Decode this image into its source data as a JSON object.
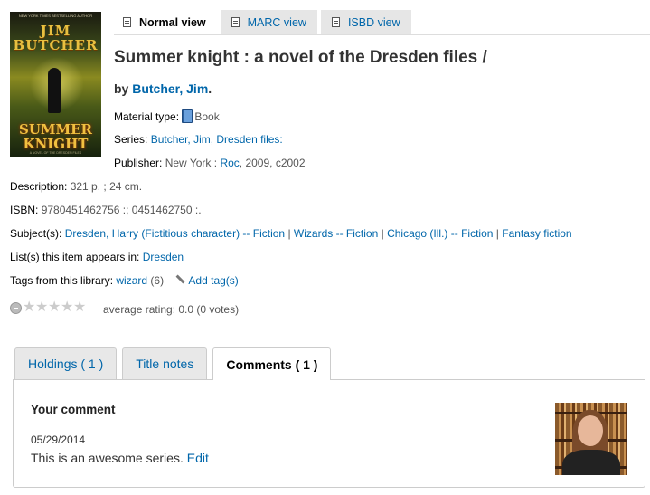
{
  "cover": {
    "tagline": "NEW YORK TIMES BESTSELLING AUTHOR",
    "author_line1": "JIM",
    "author_line2": "BUTCHER",
    "title_line1": "SUMMER",
    "title_line2": "KNIGHT",
    "subtitle": "A NOVEL OF THE DRESDEN FILES"
  },
  "view_tabs": [
    {
      "label": "Normal view",
      "icon": "document-icon"
    },
    {
      "label": "MARC view",
      "icon": "table-icon"
    },
    {
      "label": "ISBD view",
      "icon": "folder-icon"
    }
  ],
  "record": {
    "title": "Summer knight : a novel of the Dresden files /",
    "by_label": "by",
    "author": "Butcher, Jim",
    "author_suffix": ".",
    "material_type_label": "Material type:",
    "material_type": "Book",
    "series_label": "Series:",
    "series": "Butcher, Jim, Dresden files:",
    "publisher_label": "Publisher:",
    "publisher_place": "New York :",
    "publisher_name": "Roc",
    "publisher_date": ", 2009, c2002",
    "description_label": "Description:",
    "description": "321 p. ; 24 cm.",
    "isbn_label": "ISBN:",
    "isbn": "9780451462756 :; 0451462750 :.",
    "subjects_label": "Subject(s):",
    "subjects": [
      "Dresden, Harry (Fictitious character) -- Fiction",
      "Wizards -- Fiction",
      "Chicago (Ill.) -- Fiction",
      "Fantasy fiction"
    ],
    "separator": "|",
    "lists_label": "List(s) this item appears in:",
    "lists": "Dresden",
    "tags_label": "Tags from this library:",
    "tag": "wizard",
    "tag_count": "(6)",
    "add_tags": "Add tag(s)"
  },
  "rating": {
    "stars_filled": 0,
    "stars_total": 5,
    "text": "average rating: 0.0 (0 votes)"
  },
  "detail_tabs": [
    {
      "label": "Holdings ( 1 )"
    },
    {
      "label": "Title notes"
    },
    {
      "label": "Comments ( 1 )"
    }
  ],
  "comment": {
    "heading": "Your comment",
    "date": "05/29/2014",
    "text": "This is an awesome series.",
    "edit_label": "Edit"
  }
}
